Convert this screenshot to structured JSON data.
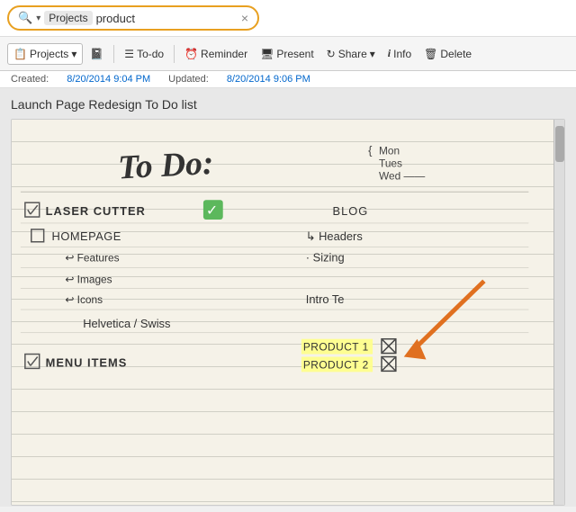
{
  "search": {
    "tag": "Projects",
    "query": "product",
    "close_label": "×"
  },
  "toolbar": {
    "projects_label": "Projects",
    "projects_dropdown": "▾",
    "todo_label": "To-do",
    "reminder_label": "Reminder",
    "present_label": "Present",
    "share_label": "Share",
    "share_dropdown": "▾",
    "info_label": "Info",
    "delete_label": "Delete"
  },
  "metadata": {
    "created_label": "Created:",
    "created_date": "8/20/2014 9:04 PM",
    "updated_label": "Updated:",
    "updated_date": "8/20/2014 9:06 PM"
  },
  "note": {
    "title": "Launch Page Redesign To Do list"
  }
}
